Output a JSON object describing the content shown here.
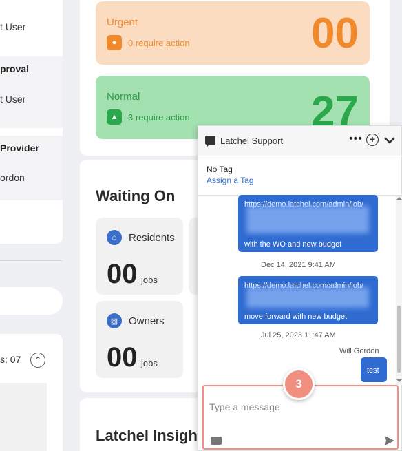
{
  "left_panel": {
    "rows": [
      {
        "title": "",
        "subtitle": "t User"
      },
      {
        "title": "proval",
        "subtitle": "t User"
      },
      {
        "title": "Provider",
        "subtitle": "ordon"
      }
    ],
    "count_text": "s: 07",
    "collapse_icon": "chevron-up-icon"
  },
  "status_cards": {
    "urgent": {
      "title": "Urgent",
      "subtitle": "0 require action",
      "count": "00",
      "icon": "circle-icon",
      "color": "#f08a2c"
    },
    "normal": {
      "title": "Normal",
      "subtitle": "3 require action",
      "count": "27",
      "icon": "triangle-icon",
      "color": "#2aa84b"
    }
  },
  "waiting_on": {
    "title": "Waiting On",
    "cards": [
      {
        "label": "Residents",
        "count": "00",
        "unit": "jobs",
        "icon": "home-icon"
      },
      {
        "label": "Owners",
        "count": "00",
        "unit": "jobs",
        "icon": "bank-icon"
      }
    ]
  },
  "insights": {
    "title": "Latchel Insigh"
  },
  "chat": {
    "title": "Latchel Support",
    "tag_label": "No Tag",
    "assign_link": "Assign a Tag",
    "messages": [
      {
        "top_line": "https://demo.latchel.com/admin/job/",
        "bottom_line": "with the WO and new budget",
        "timestamp": "Dec 14, 2021 9:41 AM"
      },
      {
        "top_line": "https://demo.latchel.com/admin/job/",
        "bottom_line": "move forward with new budget",
        "timestamp": "Jul 25, 2023 11:47 AM"
      }
    ],
    "sender": "Will Gordon",
    "last_message": "test",
    "compose_placeholder": "Type a message",
    "step_badge": "3",
    "accent_color": "#2f6bd0",
    "highlight_color": "#f08f85"
  }
}
